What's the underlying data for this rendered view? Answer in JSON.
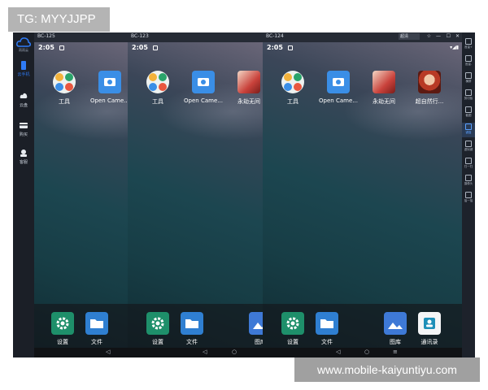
{
  "overlay": {
    "tg_label": "TG: MYYJJPP",
    "url_label": "www.mobile-kaiyuntiyu.com"
  },
  "sidebar": {
    "logo_text": "雨雨云",
    "items": [
      {
        "label": "云手机",
        "icon": "phone-icon"
      },
      {
        "label": "云盘",
        "icon": "cloud-icon"
      },
      {
        "label": "购买",
        "icon": "card-icon"
      },
      {
        "label": "客服",
        "icon": "headset-icon"
      }
    ]
  },
  "panels": [
    {
      "title": "BC-125",
      "time": "2:05",
      "apps": [
        {
          "label": "工具",
          "icon": "tools-folder-icon"
        },
        {
          "label": "Open Came...",
          "icon": "camera-icon"
        }
      ],
      "dock": [
        {
          "label": "设置",
          "icon": "settings-icon"
        },
        {
          "label": "文件",
          "icon": "files-icon"
        }
      ]
    },
    {
      "title": "BC-123",
      "time": "2:05",
      "apps": [
        {
          "label": "工具",
          "icon": "tools-folder-icon"
        },
        {
          "label": "Open Came...",
          "icon": "camera-icon"
        },
        {
          "label": "永劫无间",
          "icon": "game-icon"
        }
      ],
      "dock": [
        {
          "label": "设置",
          "icon": "settings-icon"
        },
        {
          "label": "文件",
          "icon": "files-icon"
        },
        {
          "label": "图库",
          "icon": "gallery-icon"
        }
      ]
    },
    {
      "title": "BC-124",
      "time": "2:05",
      "apps": [
        {
          "label": "工具",
          "icon": "tools-folder-icon"
        },
        {
          "label": "Open Came...",
          "icon": "camera-icon"
        },
        {
          "label": "永劫无间",
          "icon": "game-icon"
        },
        {
          "label": "超自然行...",
          "icon": "game-icon"
        }
      ],
      "dock": [
        {
          "label": "设置",
          "icon": "settings-icon"
        },
        {
          "label": "文件",
          "icon": "files-icon"
        },
        {
          "label": "图库",
          "icon": "gallery-icon"
        },
        {
          "label": "通讯录",
          "icon": "contacts-icon"
        }
      ]
    }
  ],
  "window_controls": {
    "quality": "超清"
  },
  "toolbar": {
    "items": [
      {
        "label": "音量+"
      },
      {
        "label": "音量-"
      },
      {
        "label": "横屏"
      },
      {
        "label": "剪切板"
      },
      {
        "label": "截图"
      },
      {
        "label": "键盘"
      },
      {
        "label": "虚拟键"
      },
      {
        "label": "扫一扫"
      },
      {
        "label": "摄像头"
      },
      {
        "label": "摇一摇"
      }
    ],
    "active_index": 5
  },
  "colors": {
    "accent": "#2f7bf6",
    "sidebar_bg": "#1b1f27"
  }
}
